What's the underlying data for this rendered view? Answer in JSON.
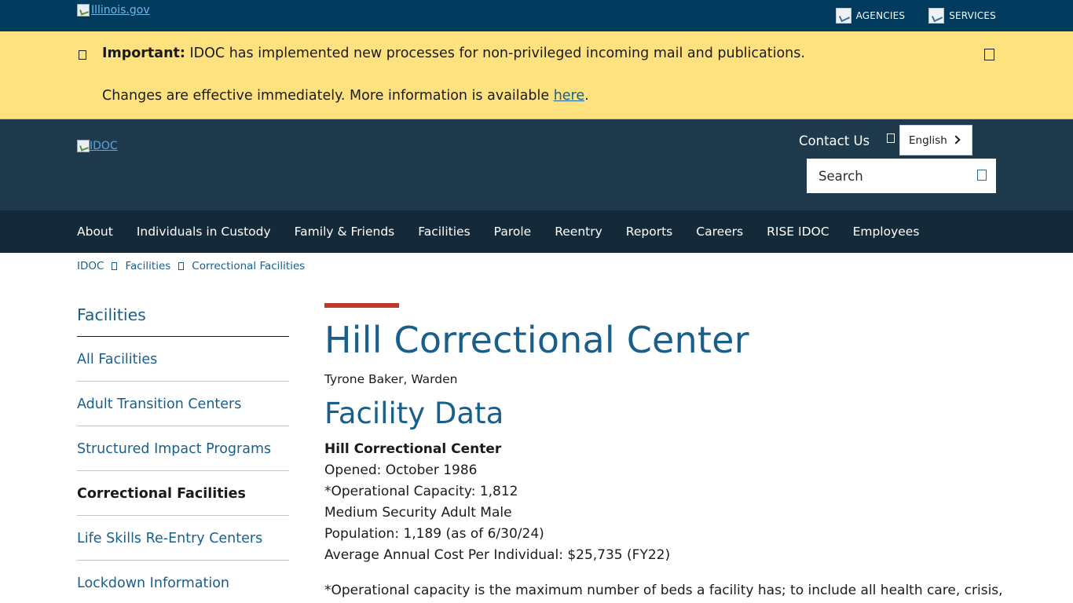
{
  "topbar": {
    "logo_alt": "Illinois.gov",
    "links": [
      {
        "label": "AGENCIES",
        "icon": "agencies-icon"
      },
      {
        "label": "SERVICES",
        "icon": "services-icon"
      }
    ]
  },
  "alert": {
    "bold": "Important:",
    "message": "IDOC has implemented new processes for non-privileged incoming mail and publications.",
    "line2_prefix": "Changes are effective immediately. More information is available",
    "link_text": "here",
    "line2_suffix": ".",
    "bell_icon": "bell-icon",
    "close_icon": "close-icon"
  },
  "header": {
    "logo_alt": "IDOC",
    "contact": "Contact Us",
    "globe_icon": "globe-icon",
    "language": "English",
    "search_placeholder": "Search",
    "search_icon": "search-icon"
  },
  "nav": {
    "items": [
      "About",
      "Individuals in Custody",
      "Family & Friends",
      "Facilities",
      "Parole",
      "Reentry",
      "Reports",
      "Careers",
      "RISE IDOC",
      "Employees"
    ]
  },
  "breadcrumb": [
    "IDOC",
    "Facilities",
    "Correctional Facilities"
  ],
  "sidebar": {
    "title": "Facilities",
    "items": [
      "All Facilities",
      "Adult Transition Centers",
      "Structured Impact Programs",
      "Correctional Facilities",
      "Life Skills Re-Entry Centers",
      "Lockdown Information"
    ],
    "active_index": 3
  },
  "content": {
    "title": "Hill Correctional Center",
    "warden": "Tyrone Baker, Warden",
    "section_title": "Facility Data",
    "facility_name": "Hill Correctional Center",
    "opened": "Opened: October 1986",
    "capacity": "*Operational Capacity: 1,812",
    "security": "Medium Security Adult Male",
    "population": "Population: 1,189 (as of 6/30/24)",
    "cost": "Average Annual Cost Per Individual: $25,735 (FY22)",
    "note": "*Operational capacity is the maximum number of beds a facility has; to include all health care, crisis,"
  },
  "colors": {
    "topbar": "#003a5d",
    "alert": "#fde27f",
    "header": "#1f3a4d",
    "nav": "#142a38",
    "link": "#1a5f8a",
    "accent": "#bb3a2c"
  }
}
